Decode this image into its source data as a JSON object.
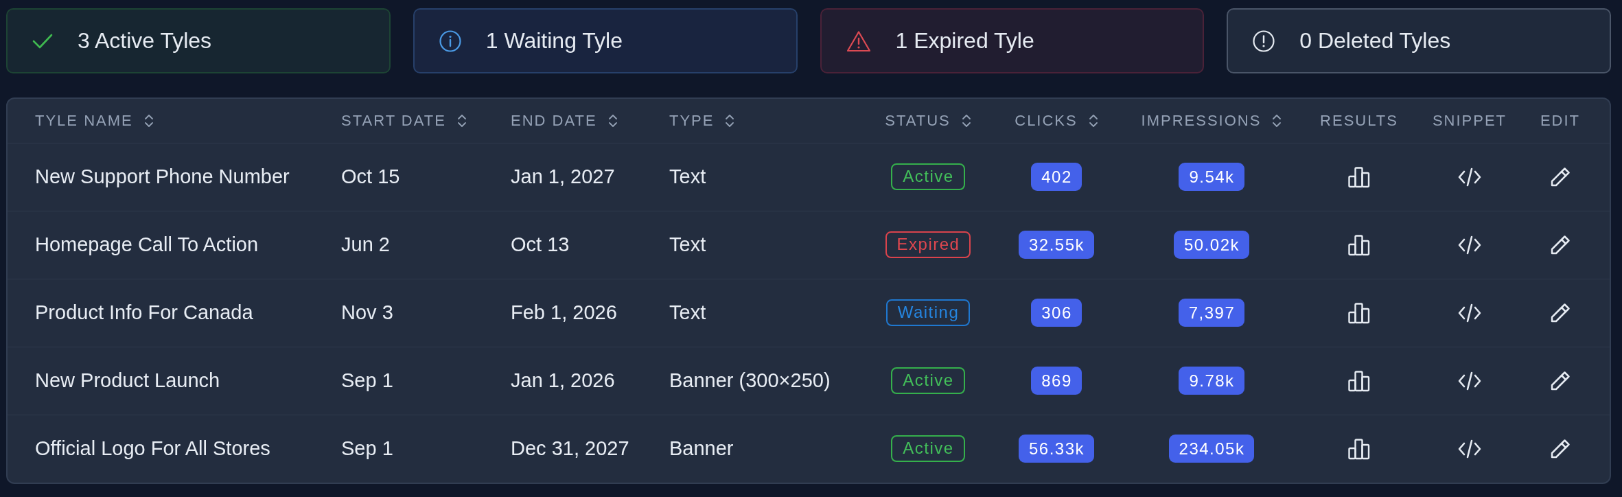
{
  "summary_cards": [
    {
      "kind": "active",
      "label": "3 Active Tyles"
    },
    {
      "kind": "waiting",
      "label": "1 Waiting Tyle"
    },
    {
      "kind": "expired",
      "label": "1 Expired Tyle"
    },
    {
      "kind": "deleted",
      "label": "0 Deleted Tyles"
    }
  ],
  "table": {
    "columns": [
      {
        "label": "TYLE NAME",
        "sortable": true
      },
      {
        "label": "START DATE",
        "sortable": true
      },
      {
        "label": "END DATE",
        "sortable": true
      },
      {
        "label": "TYPE",
        "sortable": true
      },
      {
        "label": "STATUS",
        "sortable": true
      },
      {
        "label": "CLICKS",
        "sortable": true
      },
      {
        "label": "IMPRESSIONS",
        "sortable": true
      },
      {
        "label": "RESULTS",
        "sortable": false
      },
      {
        "label": "SNIPPET",
        "sortable": false
      },
      {
        "label": "EDIT",
        "sortable": false
      }
    ],
    "rows": [
      {
        "name": "New Support Phone Number",
        "start_date": "Oct 15",
        "end_date": "Jan 1, 2027",
        "type": "Text",
        "status": {
          "kind": "active",
          "label": "Active"
        },
        "clicks": "402",
        "impressions": "9.54k"
      },
      {
        "name": "Homepage Call To Action",
        "start_date": "Jun 2",
        "end_date": "Oct 13",
        "type": "Text",
        "status": {
          "kind": "expired",
          "label": "Expired"
        },
        "clicks": "32.55k",
        "impressions": "50.02k"
      },
      {
        "name": "Product Info For Canada",
        "start_date": "Nov 3",
        "end_date": "Feb 1, 2026",
        "type": "Text",
        "status": {
          "kind": "waiting",
          "label": "Waiting"
        },
        "clicks": "306",
        "impressions": "7,397"
      },
      {
        "name": "New Product Launch",
        "start_date": "Sep 1",
        "end_date": "Jan 1, 2026",
        "type": "Banner (300×250)",
        "status": {
          "kind": "active",
          "label": "Active"
        },
        "clicks": "869",
        "impressions": "9.78k"
      },
      {
        "name": "Official Logo For All Stores",
        "start_date": "Sep 1",
        "end_date": "Dec 31, 2027",
        "type": "Banner",
        "status": {
          "kind": "active",
          "label": "Active"
        },
        "clicks": "56.33k",
        "impressions": "234.05k"
      }
    ]
  }
}
